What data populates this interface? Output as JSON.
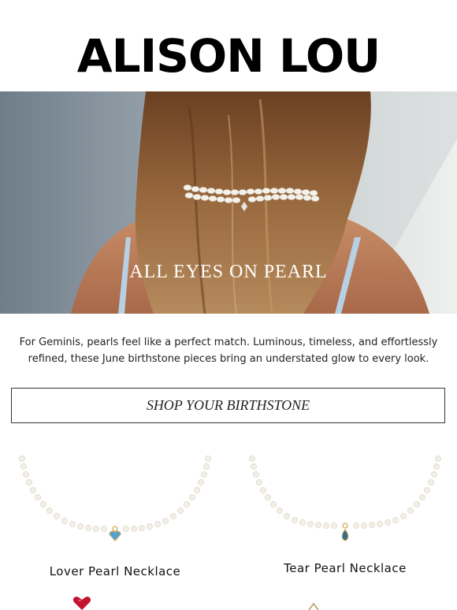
{
  "brand": {
    "logo_text": "ALISON LOU"
  },
  "hero": {
    "title": "ALL EYES ON PEARL"
  },
  "intro": {
    "text": "For Geminis, pearls feel like a perfect match. Luminous, timeless, and effortlessly refined, these June birthstone pieces bring an understated glow to every look."
  },
  "cta": {
    "label": "SHOP YOUR BIRTHSTONE"
  },
  "products": [
    {
      "name": "Lover Pearl Necklace",
      "stone_color": "#4aa3d8"
    },
    {
      "name": "Tear Pearl Necklace",
      "stone_color": "#2f6f93"
    }
  ],
  "colors": {
    "accent": "#000000",
    "ruby": "#c4112f"
  }
}
